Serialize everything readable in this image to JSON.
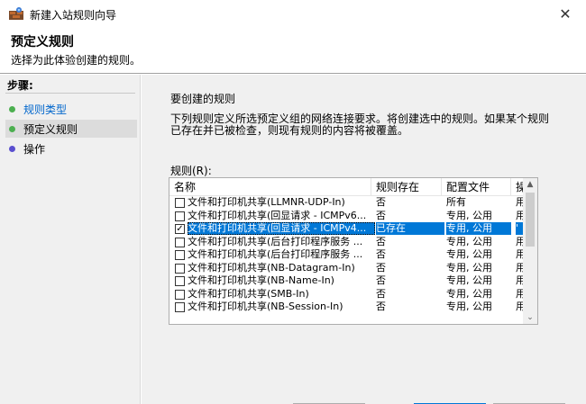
{
  "window": {
    "title": "新建入站规则向导",
    "close_glyph": "✕"
  },
  "header": {
    "title": "预定义规则",
    "subtitle": "选择为此体验创建的规则。"
  },
  "steps": {
    "heading": "步骤:",
    "items": [
      {
        "label": "规则类型",
        "state": "link",
        "dot_color": "#4caf50"
      },
      {
        "label": "预定义规则",
        "state": "current",
        "dot_color": "#4caf50"
      },
      {
        "label": "操作",
        "state": "pending",
        "dot_color": "#5a4fcf"
      }
    ]
  },
  "content": {
    "section_title": "要创建的规则",
    "description": "下列规则定义所选预定义组的网络连接要求。将创建选中的规则。如果某个规则已存在并已被检查，则现有规则的内容将被覆盖。",
    "rules_label": "规则(R):",
    "table": {
      "columns": [
        "名称",
        "规则存在",
        "配置文件",
        "操"
      ],
      "rows": [
        {
          "checked": false,
          "selected": false,
          "name": "文件和打印机共享(LLMNR-UDP-In)",
          "exists": "否",
          "profile": "所有",
          "extra": "用"
        },
        {
          "checked": false,
          "selected": false,
          "name": "文件和打印机共享(回显请求 - ICMPv6...",
          "exists": "否",
          "profile": "专用, 公用",
          "extra": "用"
        },
        {
          "checked": true,
          "selected": true,
          "name": "文件和打印机共享(回显请求 - ICMPv4...",
          "exists": "已存在",
          "profile": "专用, 公用",
          "extra": "'"
        },
        {
          "checked": false,
          "selected": false,
          "name": "文件和打印机共享(后台打印程序服务 ...",
          "exists": "否",
          "profile": "专用, 公用",
          "extra": "用"
        },
        {
          "checked": false,
          "selected": false,
          "name": "文件和打印机共享(后台打印程序服务 ...",
          "exists": "否",
          "profile": "专用, 公用",
          "extra": "用"
        },
        {
          "checked": false,
          "selected": false,
          "name": "文件和打印机共享(NB-Datagram-In)",
          "exists": "否",
          "profile": "专用, 公用",
          "extra": "用"
        },
        {
          "checked": false,
          "selected": false,
          "name": "文件和打印机共享(NB-Name-In)",
          "exists": "否",
          "profile": "专用, 公用",
          "extra": "用"
        },
        {
          "checked": false,
          "selected": false,
          "name": "文件和打印机共享(SMB-In)",
          "exists": "否",
          "profile": "专用, 公用",
          "extra": "用"
        },
        {
          "checked": false,
          "selected": false,
          "name": "文件和打印机共享(NB-Session-In)",
          "exists": "否",
          "profile": "专用, 公用",
          "extra": "用"
        }
      ],
      "scroll_up_glyph": "▲",
      "scroll_down_glyph": "⌄"
    }
  },
  "colors": {
    "selection": "#0078d7",
    "link": "#0066cc",
    "panel_bg": "#f0f0f0"
  }
}
